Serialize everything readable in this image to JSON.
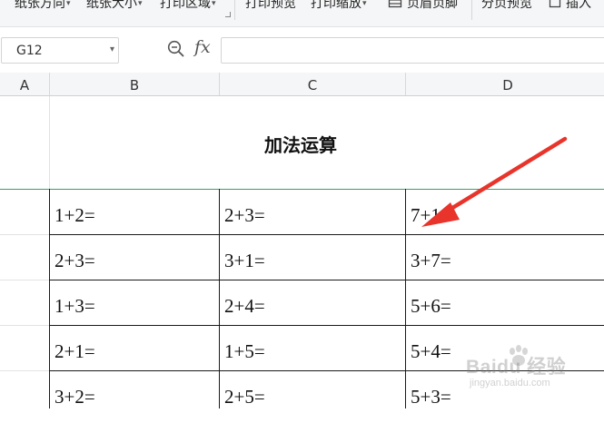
{
  "ribbon": {
    "items": [
      {
        "label": "纸张方向",
        "dropdown": true
      },
      {
        "label": "纸张大小",
        "dropdown": true
      },
      {
        "label": "打印区域",
        "dropdown": true
      },
      {
        "label": "打印预览",
        "dropdown": false
      },
      {
        "label": "打印缩放",
        "dropdown": true
      },
      {
        "label": "页眉页脚",
        "dropdown": false
      },
      {
        "label": "分页预览",
        "dropdown": false
      },
      {
        "label": "插入",
        "dropdown": false
      }
    ]
  },
  "formula_bar": {
    "name_box": "G12",
    "fx_label": "fx",
    "formula_value": ""
  },
  "columns": [
    "A",
    "B",
    "C",
    "D"
  ],
  "sheet": {
    "title": "加法运算",
    "rows": [
      [
        "1+2=",
        "2+3=",
        "7+1="
      ],
      [
        "2+3=",
        "3+1=",
        "3+7="
      ],
      [
        "1+3=",
        "2+4=",
        "5+6="
      ],
      [
        "2+1=",
        "1+5=",
        "5+4="
      ],
      [
        "3+2=",
        "2+5=",
        "5+3="
      ]
    ]
  },
  "overlay": {
    "arrow_color": "#e8342b"
  },
  "watermark": {
    "logo_text": "Baidu 经验",
    "url_text": "jingyan.baidu.com"
  }
}
